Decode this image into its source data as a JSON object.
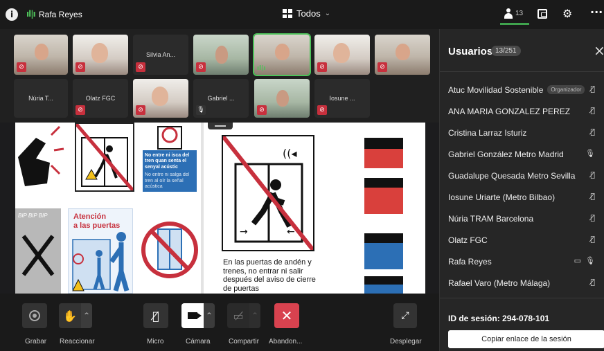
{
  "topbar": {
    "speaker_name": "Rafa Reyes",
    "view_label": "Todos",
    "users_count": "13"
  },
  "tiles": [
    {
      "name": "",
      "mic": "off"
    },
    {
      "name": "",
      "mic": "off"
    },
    {
      "name": "Silvia An...",
      "mic": "off"
    },
    {
      "name": "",
      "mic": "off"
    },
    {
      "name": "",
      "mic": "speaking"
    },
    {
      "name": "",
      "mic": "off"
    },
    {
      "name": "",
      "mic": "off"
    },
    {
      "name": "Núria T...",
      "mic": "none"
    },
    {
      "name": "Olatz FGC",
      "mic": "off"
    },
    {
      "name": "",
      "mic": "off"
    },
    {
      "name": "Gabriel ...",
      "mic": "on"
    },
    {
      "name": "",
      "mic": "off"
    },
    {
      "name": "Iosune ...",
      "mic": "off"
    }
  ],
  "share": {
    "poster_title": "Atención\na las puertas",
    "blue_sign_text": "No entre ni isca del tren quan senta el senyal acústic",
    "blue_sign_sub": "No entre ni salga del tren al oír la señal acústica",
    "bip_text": "BIP BIP BIP",
    "caption": "En las puertas de andén y trenes, no entrar ni salir después del aviso de cierre de puertas"
  },
  "panel": {
    "title": "Usuarios",
    "count": "13/251",
    "organizer_badge": "Organizador",
    "users": [
      {
        "name": "Atuc Movilidad Sostenible",
        "organizer": true,
        "icons": [
          "mic-off"
        ]
      },
      {
        "name": "ANA MARIA GONZALEZ PEREZ",
        "organizer": false,
        "icons": [
          "mic-off"
        ]
      },
      {
        "name": "Cristina Larraz Isturiz",
        "organizer": false,
        "icons": [
          "mic-off"
        ]
      },
      {
        "name": "Gabriel González Metro Madrid",
        "organizer": false,
        "icons": [
          "mic-on"
        ]
      },
      {
        "name": "Guadalupe Quesada Metro Sevilla",
        "organizer": false,
        "icons": [
          "mic-off"
        ]
      },
      {
        "name": "Iosune Uriarte (Metro Bilbao)",
        "organizer": false,
        "icons": [
          "mic-off"
        ]
      },
      {
        "name": "Núria TRAM Barcelona",
        "organizer": false,
        "icons": [
          "mic-off"
        ]
      },
      {
        "name": "Olatz FGC",
        "organizer": false,
        "icons": [
          "mic-off"
        ]
      },
      {
        "name": "Rafa Reyes",
        "organizer": false,
        "icons": [
          "screen",
          "mic-on"
        ]
      },
      {
        "name": "Rafael Varo (Metro Málaga)",
        "organizer": false,
        "icons": [
          "mic-off"
        ]
      }
    ],
    "session_id": "ID de sesión: 294-078-101",
    "copy_link": "Copiar enlace de la sesión"
  },
  "toolbar": {
    "record": "Grabar",
    "react": "Reaccionar",
    "mic": "Micro",
    "camera": "Cámara",
    "share": "Compartir",
    "leave": "Abandon...",
    "expand": "Desplegar"
  },
  "colors": {
    "accent_green": "#4ec25a",
    "mute_red": "#c7303d",
    "leave_red": "#d8424f",
    "sign_blue": "#2c6fb5"
  }
}
